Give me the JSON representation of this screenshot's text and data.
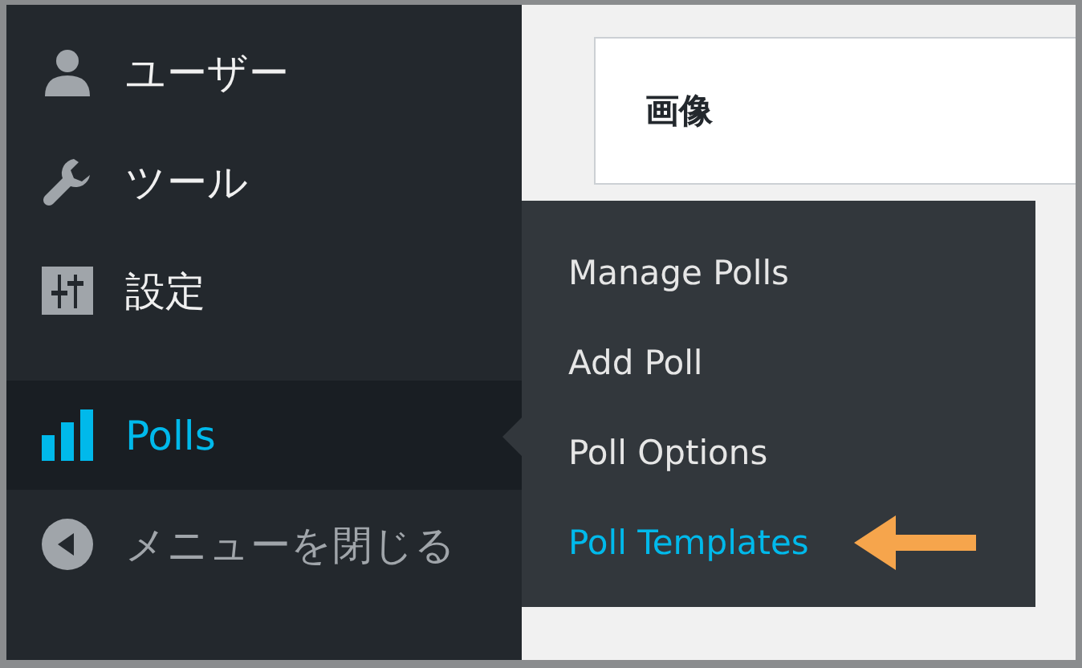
{
  "sidebar": {
    "items": [
      {
        "label": "ユーザー",
        "selected": false
      },
      {
        "label": "ツール",
        "selected": false
      },
      {
        "label": "設定",
        "selected": false
      },
      {
        "label": "Polls",
        "selected": true
      }
    ],
    "collapse": {
      "label": "メニューを閉じる"
    }
  },
  "content": {
    "card_title": "画像"
  },
  "flyout": {
    "items": [
      {
        "label": "Manage Polls",
        "selected": false
      },
      {
        "label": "Add Poll",
        "selected": false
      },
      {
        "label": "Poll Options",
        "selected": false
      },
      {
        "label": "Poll Templates",
        "selected": true
      }
    ]
  }
}
